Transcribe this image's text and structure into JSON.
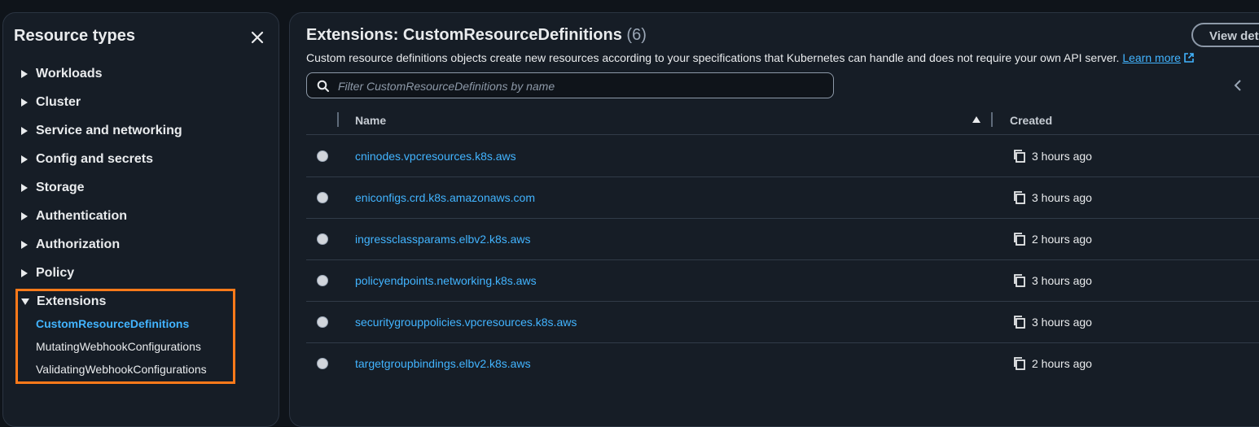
{
  "sidebar": {
    "title": "Resource types",
    "items": [
      {
        "label": "Workloads"
      },
      {
        "label": "Cluster"
      },
      {
        "label": "Service and networking"
      },
      {
        "label": "Config and secrets"
      },
      {
        "label": "Storage"
      },
      {
        "label": "Authentication"
      },
      {
        "label": "Authorization"
      },
      {
        "label": "Policy"
      },
      {
        "label": "Extensions",
        "expanded": true
      }
    ],
    "sub_items": [
      {
        "label": "CustomResourceDefinitions",
        "active": true
      },
      {
        "label": "MutatingWebhookConfigurations"
      },
      {
        "label": "ValidatingWebhookConfigurations"
      }
    ]
  },
  "main": {
    "title": "Extensions: CustomResourceDefinitions",
    "count": "(6)",
    "view_button": "View deta",
    "description": "Custom resource definitions objects create new resources according to your specifications that Kubernetes can handle and does not require your own API server.",
    "learn_more": "Learn more",
    "search_placeholder": "Filter CustomResourceDefinitions by name",
    "columns": {
      "name": "Name",
      "created": "Created"
    },
    "rows": [
      {
        "name": "cninodes.vpcresources.k8s.aws",
        "created": "3 hours ago"
      },
      {
        "name": "eniconfigs.crd.k8s.amazonaws.com",
        "created": "3 hours ago"
      },
      {
        "name": "ingressclassparams.elbv2.k8s.aws",
        "created": "2 hours ago"
      },
      {
        "name": "policyendpoints.networking.k8s.aws",
        "created": "3 hours ago"
      },
      {
        "name": "securitygrouppolicies.vpcresources.k8s.aws",
        "created": "3 hours ago"
      },
      {
        "name": "targetgroupbindings.elbv2.k8s.aws",
        "created": "2 hours ago"
      }
    ]
  },
  "colors": {
    "background": "#0f141a",
    "panel": "#161d26",
    "link": "#42b4ff",
    "highlight": "#ff7a1a",
    "text": "#e9ebed"
  },
  "icons": [
    "close-icon",
    "caret-right-icon",
    "caret-down-icon",
    "search-icon",
    "external-link-icon",
    "chevron-left-icon",
    "sort-ascending-icon",
    "copy-icon"
  ]
}
